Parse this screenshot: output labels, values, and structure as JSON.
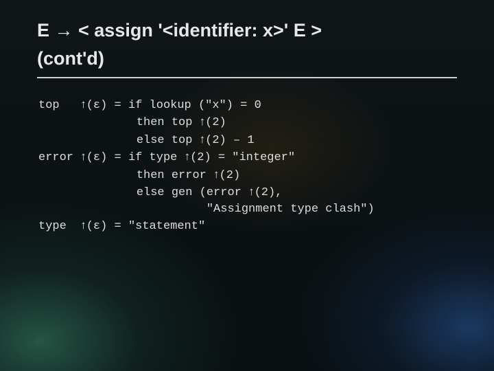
{
  "title_line1": "E → < assign '<identifier: x>' E >",
  "title_line2": "(cont'd)",
  "rules": {
    "r1": {
      "attr": "top",
      "arg": "(ε)",
      "eq": "=",
      "l1a": "if lookup (\"x\") = 0",
      "l2a": "then top ",
      "l2b": "(2)",
      "l3a": "else top ",
      "l3b": "(2) – 1"
    },
    "r2": {
      "attr": "error",
      "arg": "(ε)",
      "eq": "=",
      "l1a": "if type ",
      "l1b": "(2) = \"integer\"",
      "l2a": "then error ",
      "l2b": "(2)",
      "l3a": "else gen (error ",
      "l3b": "(2),",
      "l4": "\"Assignment type clash\")"
    },
    "r3": {
      "attr": "type",
      "arg": "(ε)",
      "eq": "=",
      "l1": "\"statement\""
    }
  },
  "up": "↑"
}
